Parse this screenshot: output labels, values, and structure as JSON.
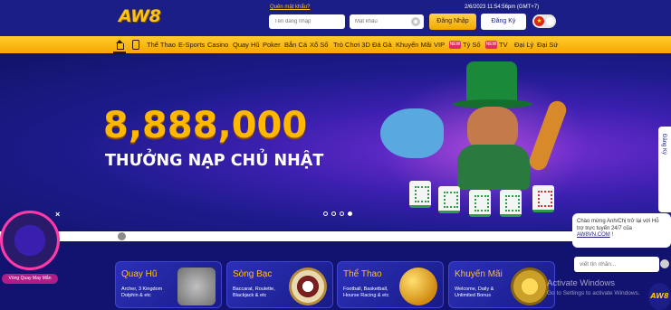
{
  "header": {
    "logo_text": "AW8",
    "forgot_password": "Quên mật khẩu?",
    "datetime": "2/6/2023 11:54:56pm (GMT+7)",
    "username_placeholder": "Tên đăng nhập",
    "password_placeholder": "Mật khẩu",
    "login_label": "Đăng Nhập",
    "register_label": "Đăng Ký",
    "language_flag": "★"
  },
  "nav": {
    "items": [
      "Thể Thao",
      "E-Sports",
      "Casino",
      "Quay Hũ",
      "Poker",
      "Bắn Cá",
      "Xổ Số",
      "Trò Chơi 3D",
      "Đá Gà",
      "Khuyến Mãi",
      "VIP",
      "Tỷ Số",
      "TV",
      "Đại Lý",
      "Đại Sứ"
    ],
    "badges": [
      "NEW",
      "NEW"
    ]
  },
  "banner": {
    "amount": "8,888,000",
    "subtitle": "THƯỞNG NẠP CHỦ NHẬT",
    "slide_count": 4,
    "active_slide": 4,
    "side_tab": "Đăng Ký"
  },
  "wheel": {
    "label": "Vòng Quay May Mắn",
    "close": "×"
  },
  "cards": [
    {
      "title": "Quay Hũ",
      "desc": "Archer, 3 Kingdom Dolphin & etc"
    },
    {
      "title": "Sòng Bạc",
      "desc": "Baccarat, Roulette, Blackjack & etc"
    },
    {
      "title": "Thể Thao",
      "desc": "Football, Basketball, Hourse Racing & etc"
    },
    {
      "title": "Khuyến Mãi",
      "desc": "Welcome, Daily & Unlimited Bonus"
    }
  ],
  "chat": {
    "message": "Chào mừng Anh/Chị trở lại với Hỗ trợ trực tuyến 24/7 của",
    "link": "AW8VN.COM",
    "message_end": "!",
    "input_placeholder": "viết tin nhắn...",
    "logo_text": "AW8"
  },
  "watermark": {
    "title": "Activate Windows",
    "subtitle": "Go to Settings to activate Windows."
  },
  "colors": {
    "header_bg": "#1b1e87",
    "nav_gold": "#ffcc2e",
    "accent_gold": "#ffc20e",
    "body_bg": "#0f1160"
  }
}
